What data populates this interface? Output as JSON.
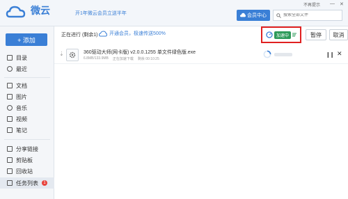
{
  "header": {
    "app_name": "微云",
    "promo": "开1年微云会员立送半年",
    "member_center": "会员中心",
    "search_placeholder": "搜索全部文件",
    "top_link": "不再提示",
    "win_minimize": "—",
    "win_close": "✕"
  },
  "sidebar": {
    "add_label": "+ 添加",
    "items": [
      {
        "label": "目录"
      },
      {
        "label": "最近"
      },
      {
        "label": "文档"
      },
      {
        "label": "图片"
      },
      {
        "label": "音乐"
      },
      {
        "label": "视频"
      },
      {
        "label": "笔记"
      },
      {
        "label": "分享链接"
      },
      {
        "label": "剪贴板"
      },
      {
        "label": "回收站"
      },
      {
        "label": "任务列表",
        "badge": "1"
      }
    ]
  },
  "toolbar": {
    "status": "正在进行 (剩余1)",
    "open_member": "开通会员，极速传送500%",
    "accel_label": "加速中",
    "pause": "暂停",
    "cancel": "取消"
  },
  "task": {
    "filename": "360驱动大师(网卡版) v2.0.0.1255 单文件绿色版.exe",
    "size": "6.8MB/133.9MB",
    "state": "正在加速下载",
    "time_left": "剩余 00:10:25"
  },
  "colors": {
    "accent": "#3a7fd6",
    "accel_green": "#2e9a5a",
    "highlight_red": "#e02020",
    "badge_red": "#e8423b"
  }
}
